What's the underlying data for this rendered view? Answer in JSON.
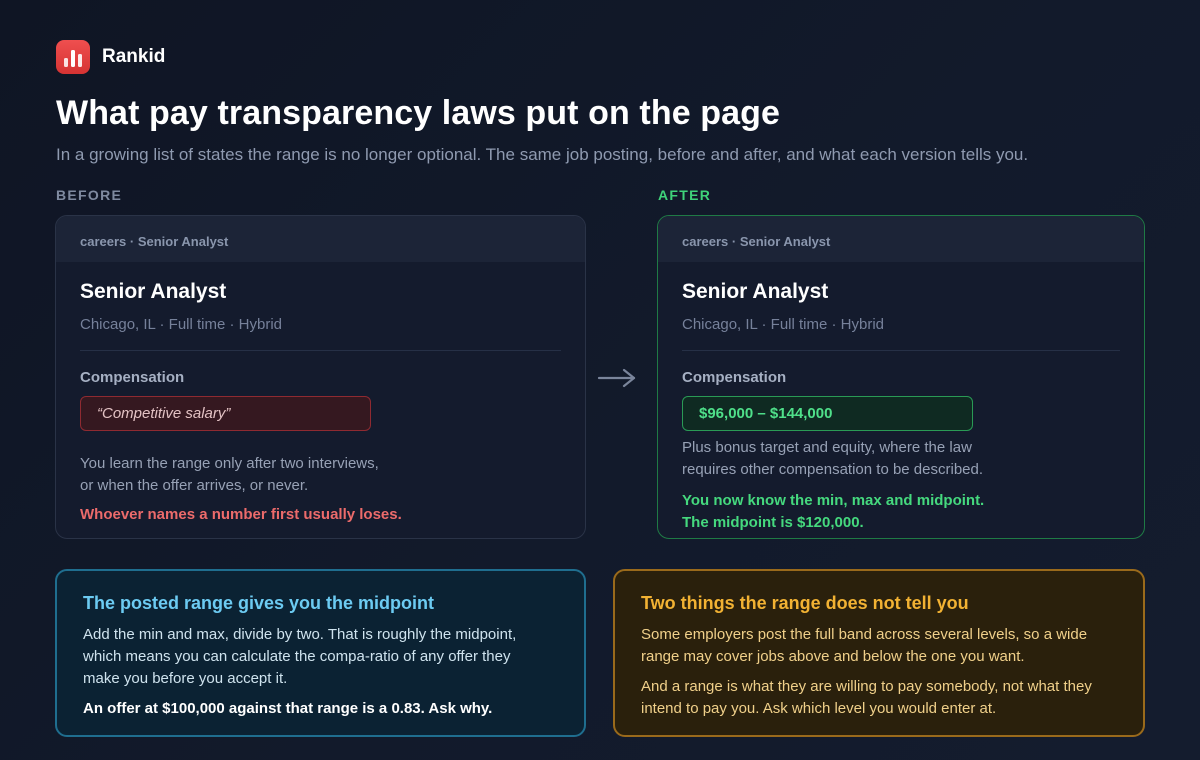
{
  "brand": {
    "name": "Rankid",
    "icon": "bar-chart-icon",
    "color": "#e03e3e"
  },
  "header": {
    "title": "What pay transparency laws put on the page",
    "subtitle": "In a growing list of states the range is no longer optional. The same job posting, before and after, and what each version tells you."
  },
  "before": {
    "label": "BEFORE",
    "breadcrumb": "careers · Senior Analyst",
    "job_title": "Senior Analyst",
    "meta": "Chicago, IL · Full time · Hybrid",
    "comp_label": "Compensation",
    "comp_value": "“Competitive salary”",
    "note_line1": "You learn the range only after two interviews,",
    "note_line2": "or when the offer arrives, or never.",
    "warning": "Whoever names a number first usually loses."
  },
  "after": {
    "label": "AFTER",
    "breadcrumb": "careers · Senior Analyst",
    "job_title": "Senior Analyst",
    "meta": "Chicago, IL · Full time · Hybrid",
    "comp_label": "Compensation",
    "comp_value": "$96,000 – $144,000",
    "note_line1": "Plus bonus target and equity, where the law",
    "note_line2": "requires other compensation to be described.",
    "good_line1": "You now know the min, max and midpoint.",
    "good_line2": "The midpoint is $120,000."
  },
  "arrow_icon": "arrow-right-icon",
  "midpoint_box": {
    "title": "The posted range gives you the midpoint",
    "text": "Add the min and max, divide by two. That is roughly the midpoint, which means you can calculate the compa-ratio of any offer they make you before you accept it.",
    "strong": "An offer at $100,000 against that range is a 0.83. Ask why."
  },
  "caveat_box": {
    "title": "Two things the range does not tell you",
    "text1": "Some employers post the full band across several levels, so a wide range may cover jobs above and below the one you want.",
    "text2": "And a range is what they are willing to pay somebody, not what they intend to pay you. Ask which level you would enter at."
  },
  "colors": {
    "positive": "#3fd27a",
    "negative": "#ec6b6b",
    "info": "#6ccbf2",
    "caution": "#f2b233"
  }
}
